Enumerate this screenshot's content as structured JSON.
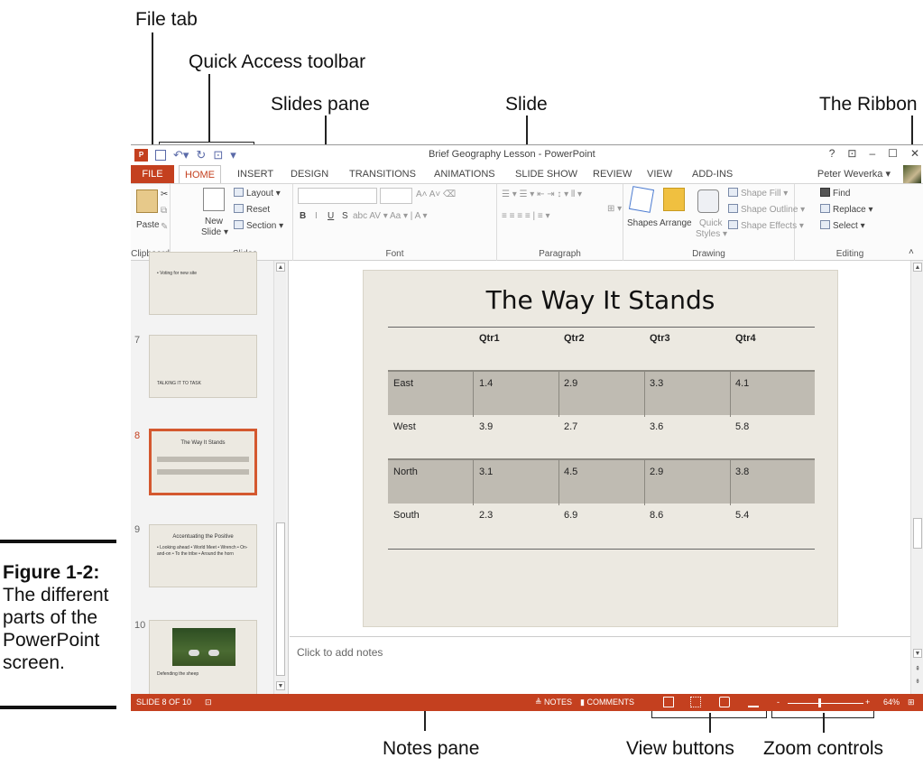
{
  "callouts": {
    "file_tab": "File tab",
    "quick_access": "Quick Access toolbar",
    "slides_pane": "Slides pane",
    "slide": "Slide",
    "ribbon": "The Ribbon",
    "notes_pane": "Notes pane",
    "view_buttons": "View buttons",
    "zoom_controls": "Zoom controls"
  },
  "figure": {
    "label": "Figure 1-2:",
    "caption": "The different parts of the PowerPoint screen."
  },
  "window": {
    "title": "Brief Geography Lesson - PowerPoint",
    "logo": "P",
    "controls": [
      "?",
      "⊡",
      "–",
      "☐",
      "✕"
    ],
    "user": "Peter Weverka ▾"
  },
  "tabs": [
    "FILE",
    "HOME",
    "INSERT",
    "DESIGN",
    "TRANSITIONS",
    "ANIMATIONS",
    "SLIDE SHOW",
    "REVIEW",
    "VIEW",
    "ADD-INS"
  ],
  "ribbon": {
    "clipboard": {
      "label": "Clipboard",
      "paste": "Paste"
    },
    "slides": {
      "label": "Slides",
      "new_slide": "New",
      "new_slide2": "Slide ▾",
      "layout": "Layout ▾",
      "reset": "Reset",
      "section": "Section ▾"
    },
    "font": {
      "label": "Font"
    },
    "paragraph": {
      "label": "Paragraph"
    },
    "drawing": {
      "label": "Drawing",
      "shapes": "Shapes",
      "arrange": "Arrange",
      "quick": "Quick",
      "styles": "Styles ▾",
      "shape_fill": "Shape Fill ▾",
      "shape_outline": "Shape Outline ▾",
      "shape_effects": "Shape Effects ▾"
    },
    "editing": {
      "label": "Editing",
      "find": "Find",
      "replace": "Replace ▾",
      "select": "Select ▾"
    }
  },
  "slides_pane": {
    "thumbs": [
      {
        "num": "",
        "title": "",
        "text": "• Voting for new site"
      },
      {
        "num": "7",
        "title": "",
        "text": "TALKING IT TO TASK"
      },
      {
        "num": "8",
        "title": "The Way It Stands",
        "text": ""
      },
      {
        "num": "9",
        "title": "Accentuating the Positive",
        "text": "• Looking ahead • World Meet • Wrench • On-and-on • To the tribe • Around the horn"
      },
      {
        "num": "10",
        "title": "",
        "text": "Defending the sheep"
      }
    ]
  },
  "slide": {
    "title": "The Way It Stands",
    "columns": [
      "",
      "Qtr1",
      "Qtr2",
      "Qtr3",
      "Qtr4"
    ],
    "rows": [
      [
        "East",
        "1.4",
        "2.9",
        "3.3",
        "4.1"
      ],
      [
        "West",
        "3.9",
        "2.7",
        "3.6",
        "5.8"
      ],
      [
        "North",
        "3.1",
        "4.5",
        "2.9",
        "3.8"
      ],
      [
        "South",
        "2.3",
        "6.9",
        "8.6",
        "5.4"
      ]
    ]
  },
  "notes": {
    "placeholder": "Click to add notes"
  },
  "status": {
    "slide_count": "SLIDE 8 OF 10",
    "notes": "≜ NOTES",
    "comments": "COMMENTS",
    "zoom": "64%",
    "zoom_minus": "-",
    "zoom_plus": "+"
  }
}
